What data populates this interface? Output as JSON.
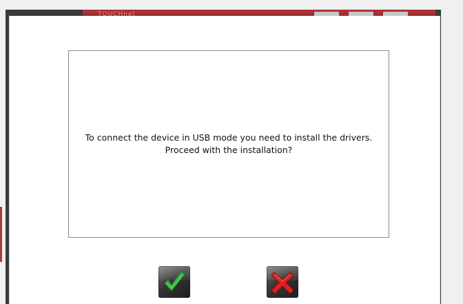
{
  "window": {
    "title": "TOUCHnet"
  },
  "dialog": {
    "message_line1": "To connect the device in USB mode you need to install the drivers.",
    "message_line2": "Proceed with the installation?"
  },
  "buttons": {
    "confirm_icon": "checkmark-icon",
    "cancel_icon": "x-icon"
  },
  "colors": {
    "confirm": "#3cb043",
    "cancel": "#e02020",
    "titlebar": "#a02a30"
  }
}
